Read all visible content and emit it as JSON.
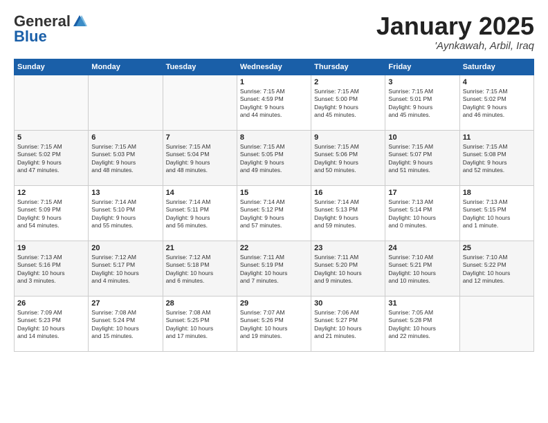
{
  "logo": {
    "general": "General",
    "blue": "Blue"
  },
  "calendar": {
    "title": "January 2025",
    "subtitle": "'Aynkawah, Arbil, Iraq"
  },
  "headers": [
    "Sunday",
    "Monday",
    "Tuesday",
    "Wednesday",
    "Thursday",
    "Friday",
    "Saturday"
  ],
  "weeks": [
    [
      {
        "day": "",
        "text": ""
      },
      {
        "day": "",
        "text": ""
      },
      {
        "day": "",
        "text": ""
      },
      {
        "day": "1",
        "text": "Sunrise: 7:15 AM\nSunset: 4:59 PM\nDaylight: 9 hours\nand 44 minutes."
      },
      {
        "day": "2",
        "text": "Sunrise: 7:15 AM\nSunset: 5:00 PM\nDaylight: 9 hours\nand 45 minutes."
      },
      {
        "day": "3",
        "text": "Sunrise: 7:15 AM\nSunset: 5:01 PM\nDaylight: 9 hours\nand 45 minutes."
      },
      {
        "day": "4",
        "text": "Sunrise: 7:15 AM\nSunset: 5:02 PM\nDaylight: 9 hours\nand 46 minutes."
      }
    ],
    [
      {
        "day": "5",
        "text": "Sunrise: 7:15 AM\nSunset: 5:02 PM\nDaylight: 9 hours\nand 47 minutes."
      },
      {
        "day": "6",
        "text": "Sunrise: 7:15 AM\nSunset: 5:03 PM\nDaylight: 9 hours\nand 48 minutes."
      },
      {
        "day": "7",
        "text": "Sunrise: 7:15 AM\nSunset: 5:04 PM\nDaylight: 9 hours\nand 48 minutes."
      },
      {
        "day": "8",
        "text": "Sunrise: 7:15 AM\nSunset: 5:05 PM\nDaylight: 9 hours\nand 49 minutes."
      },
      {
        "day": "9",
        "text": "Sunrise: 7:15 AM\nSunset: 5:06 PM\nDaylight: 9 hours\nand 50 minutes."
      },
      {
        "day": "10",
        "text": "Sunrise: 7:15 AM\nSunset: 5:07 PM\nDaylight: 9 hours\nand 51 minutes."
      },
      {
        "day": "11",
        "text": "Sunrise: 7:15 AM\nSunset: 5:08 PM\nDaylight: 9 hours\nand 52 minutes."
      }
    ],
    [
      {
        "day": "12",
        "text": "Sunrise: 7:15 AM\nSunset: 5:09 PM\nDaylight: 9 hours\nand 54 minutes."
      },
      {
        "day": "13",
        "text": "Sunrise: 7:14 AM\nSunset: 5:10 PM\nDaylight: 9 hours\nand 55 minutes."
      },
      {
        "day": "14",
        "text": "Sunrise: 7:14 AM\nSunset: 5:11 PM\nDaylight: 9 hours\nand 56 minutes."
      },
      {
        "day": "15",
        "text": "Sunrise: 7:14 AM\nSunset: 5:12 PM\nDaylight: 9 hours\nand 57 minutes."
      },
      {
        "day": "16",
        "text": "Sunrise: 7:14 AM\nSunset: 5:13 PM\nDaylight: 9 hours\nand 59 minutes."
      },
      {
        "day": "17",
        "text": "Sunrise: 7:13 AM\nSunset: 5:14 PM\nDaylight: 10 hours\nand 0 minutes."
      },
      {
        "day": "18",
        "text": "Sunrise: 7:13 AM\nSunset: 5:15 PM\nDaylight: 10 hours\nand 1 minute."
      }
    ],
    [
      {
        "day": "19",
        "text": "Sunrise: 7:13 AM\nSunset: 5:16 PM\nDaylight: 10 hours\nand 3 minutes."
      },
      {
        "day": "20",
        "text": "Sunrise: 7:12 AM\nSunset: 5:17 PM\nDaylight: 10 hours\nand 4 minutes."
      },
      {
        "day": "21",
        "text": "Sunrise: 7:12 AM\nSunset: 5:18 PM\nDaylight: 10 hours\nand 6 minutes."
      },
      {
        "day": "22",
        "text": "Sunrise: 7:11 AM\nSunset: 5:19 PM\nDaylight: 10 hours\nand 7 minutes."
      },
      {
        "day": "23",
        "text": "Sunrise: 7:11 AM\nSunset: 5:20 PM\nDaylight: 10 hours\nand 9 minutes."
      },
      {
        "day": "24",
        "text": "Sunrise: 7:10 AM\nSunset: 5:21 PM\nDaylight: 10 hours\nand 10 minutes."
      },
      {
        "day": "25",
        "text": "Sunrise: 7:10 AM\nSunset: 5:22 PM\nDaylight: 10 hours\nand 12 minutes."
      }
    ],
    [
      {
        "day": "26",
        "text": "Sunrise: 7:09 AM\nSunset: 5:23 PM\nDaylight: 10 hours\nand 14 minutes."
      },
      {
        "day": "27",
        "text": "Sunrise: 7:08 AM\nSunset: 5:24 PM\nDaylight: 10 hours\nand 15 minutes."
      },
      {
        "day": "28",
        "text": "Sunrise: 7:08 AM\nSunset: 5:25 PM\nDaylight: 10 hours\nand 17 minutes."
      },
      {
        "day": "29",
        "text": "Sunrise: 7:07 AM\nSunset: 5:26 PM\nDaylight: 10 hours\nand 19 minutes."
      },
      {
        "day": "30",
        "text": "Sunrise: 7:06 AM\nSunset: 5:27 PM\nDaylight: 10 hours\nand 21 minutes."
      },
      {
        "day": "31",
        "text": "Sunrise: 7:05 AM\nSunset: 5:28 PM\nDaylight: 10 hours\nand 22 minutes."
      },
      {
        "day": "",
        "text": ""
      }
    ]
  ]
}
